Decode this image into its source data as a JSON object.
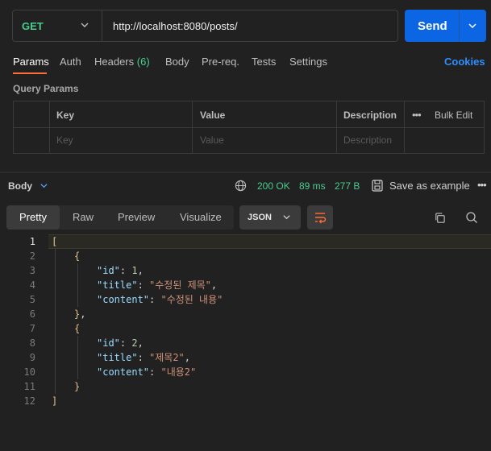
{
  "request": {
    "method": "GET",
    "url": "http://localhost:8080/posts/",
    "send_label": "Send"
  },
  "tabs": {
    "params": "Params",
    "auth": "Auth",
    "headers": "Headers",
    "headers_count": "(6)",
    "body": "Body",
    "prereq": "Pre-req.",
    "tests": "Tests",
    "settings": "Settings",
    "cookies": "Cookies"
  },
  "query_params": {
    "title": "Query Params",
    "col_key": "Key",
    "col_value": "Value",
    "col_description": "Description",
    "bulk_edit": "Bulk Edit",
    "ph_key": "Key",
    "ph_value": "Value",
    "ph_description": "Description"
  },
  "response": {
    "body_label": "Body",
    "status": "200 OK",
    "time": "89 ms",
    "size": "277 B",
    "save_label": "Save as example",
    "views": [
      "Pretty",
      "Raw",
      "Preview",
      "Visualize"
    ],
    "format": "JSON"
  },
  "code_lines": [
    {
      "n": "1",
      "t": "["
    },
    {
      "n": "2",
      "t": "{"
    },
    {
      "n": "3",
      "t": "\"id\": 1,"
    },
    {
      "n": "4",
      "t": "\"title\": \"수정된 제목\","
    },
    {
      "n": "5",
      "t": "\"content\": \"수정된 내용\""
    },
    {
      "n": "6",
      "t": "},"
    },
    {
      "n": "7",
      "t": "{"
    },
    {
      "n": "8",
      "t": "\"id\": 2,"
    },
    {
      "n": "9",
      "t": "\"title\": \"제목2\","
    },
    {
      "n": "10",
      "t": "\"content\": \"내용2\""
    },
    {
      "n": "11",
      "t": "}"
    },
    {
      "n": "12",
      "t": "]"
    }
  ],
  "colors": {
    "accent": "#0c66e4",
    "method": "#49cc90",
    "status": "#49cc90",
    "active_tab": "#ff6c37",
    "cookies": "#2f8eff"
  }
}
